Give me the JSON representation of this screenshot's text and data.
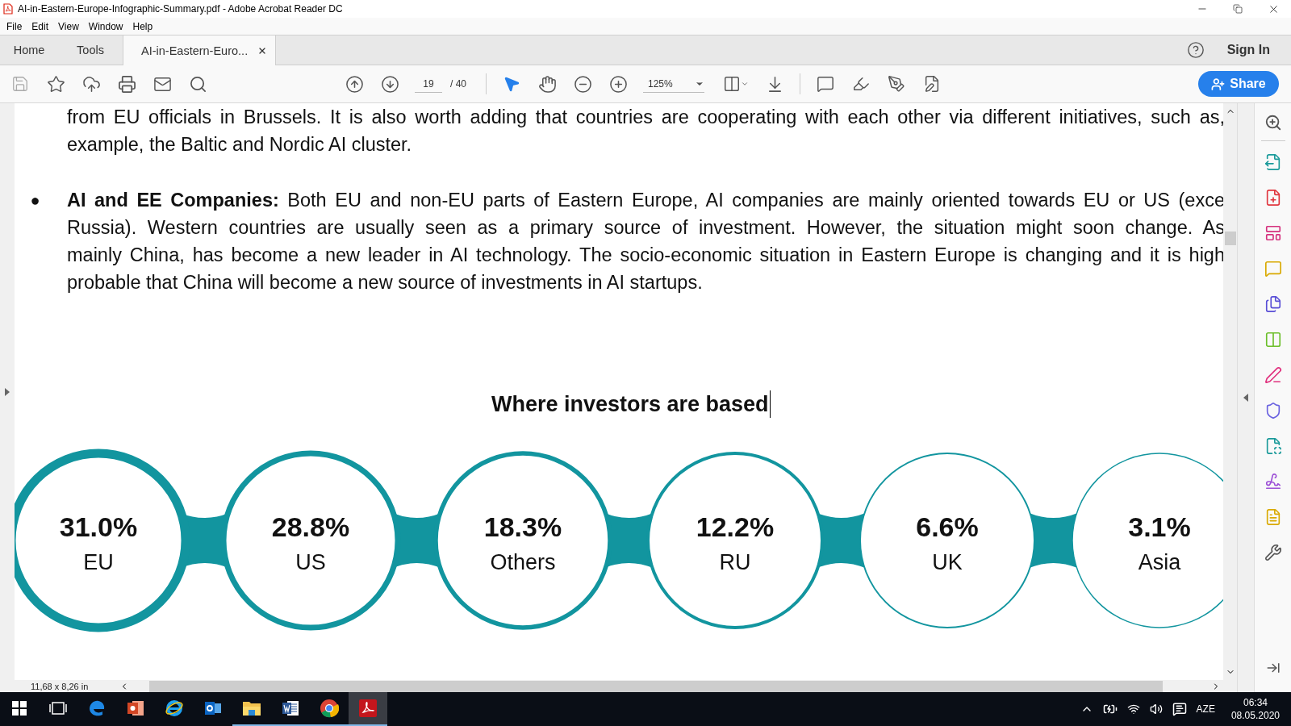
{
  "window": {
    "title": "AI-in-Eastern-Europe-Infographic-Summary.pdf - Adobe Acrobat Reader DC"
  },
  "menu": [
    "File",
    "Edit",
    "View",
    "Window",
    "Help"
  ],
  "tabs": [
    {
      "label": "Home",
      "selected": false,
      "kind": "nav"
    },
    {
      "label": "Tools",
      "selected": false,
      "kind": "nav"
    },
    {
      "label": "AI-in-Eastern-Euro...",
      "selected": true,
      "kind": "document"
    }
  ],
  "account": {
    "sign_in": "Sign In"
  },
  "toolbar": {
    "page": "19",
    "pages": "/ 40",
    "zoom": "125%",
    "share": "Share"
  },
  "document": {
    "paragraphs": [
      {
        "kind": "plain",
        "lines": [
          "from EU officials in Brussels. It is also worth adding that countries are cooperating with each other via different initiatives, such as,",
          "example, the Baltic and Nordic AI cluster."
        ]
      },
      {
        "kind": "bullet",
        "bullet": "●",
        "lines": [
          "**AI and EE Companies:** Both EU and non-EU parts of Eastern Europe, AI companies are mainly oriented towards EU or US (exce",
          "Russia). Western countries are usually seen as a primary source of investment. However, the situation might soon change. As",
          "mainly China, has become a new leader in AI technology. The socio-economic situation in Eastern Europe is changing and it is high",
          "probable that China will become a new source of investments in AI startups."
        ]
      }
    ],
    "heading": "Where investors are based",
    "investors": [
      {
        "value": "31.0%",
        "label": "EU"
      },
      {
        "value": "28.8%",
        "label": "US"
      },
      {
        "value": "18.3%",
        "label": "Others"
      },
      {
        "value": "12.2%",
        "label": "RU"
      },
      {
        "value": "6.6%",
        "label": "UK"
      },
      {
        "value": "3.1%",
        "label": "Asia"
      }
    ]
  },
  "status_bar": {
    "page_size": "11,68 x 8,26 in"
  },
  "taskbar": {
    "apps": [
      {
        "kind": "start",
        "running": false,
        "selected": false
      },
      {
        "kind": "taskview",
        "running": false,
        "selected": false
      },
      {
        "kind": "edge",
        "running": false,
        "selected": false
      },
      {
        "kind": "powerpoint",
        "running": false,
        "selected": false
      },
      {
        "kind": "ie",
        "running": false,
        "selected": false
      },
      {
        "kind": "outlook",
        "running": false,
        "selected": false
      },
      {
        "kind": "explorer",
        "running": true,
        "selected": false
      },
      {
        "kind": "word",
        "running": true,
        "selected": false
      },
      {
        "kind": "chrome",
        "running": true,
        "selected": false
      },
      {
        "kind": "acrobat",
        "running": true,
        "selected": true
      }
    ],
    "language": "AZE",
    "time": "06:34",
    "date": "08.05.2020"
  }
}
